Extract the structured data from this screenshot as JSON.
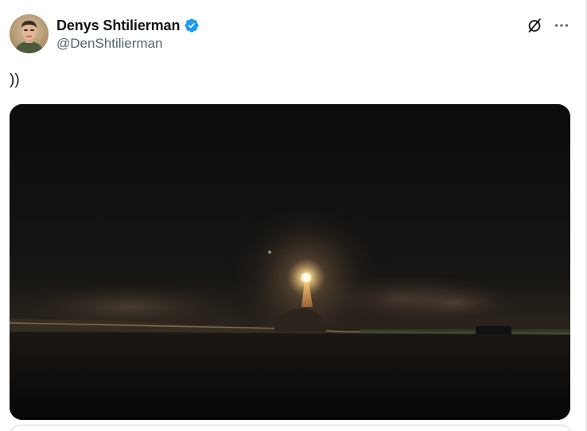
{
  "author": {
    "display_name": "Denys Shtilierman",
    "handle": "@DenShtilierman",
    "verified": true,
    "verified_color": "#1d9bf0"
  },
  "tweet": {
    "text": "))"
  },
  "actions": {
    "grok_icon": "grok-icon",
    "more_icon": "more-icon"
  },
  "media": {
    "type": "photo",
    "scene": "night-rocket-launch"
  }
}
